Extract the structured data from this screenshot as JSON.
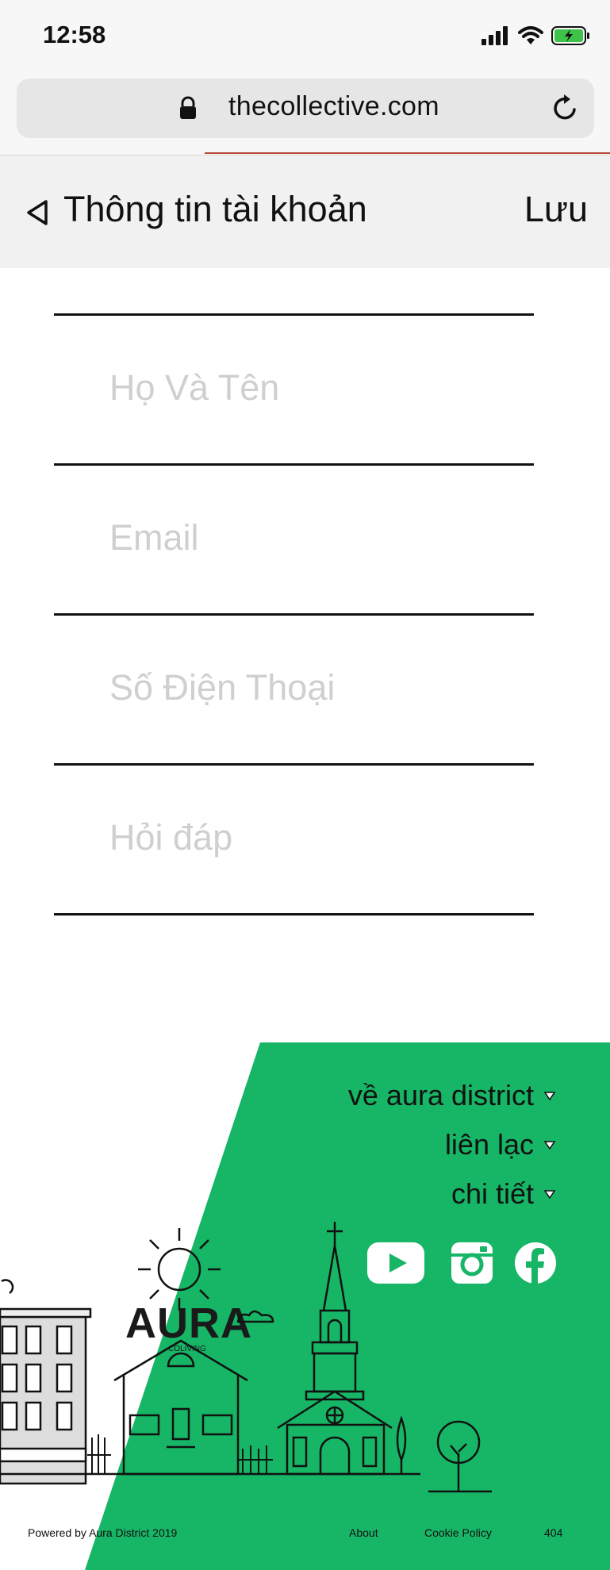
{
  "status_bar": {
    "time": "12:58"
  },
  "browser": {
    "url": "thecollective.com"
  },
  "nav": {
    "title": "Thông tin tài khoản",
    "save_label": "Lưu"
  },
  "form": {
    "fields": [
      {
        "placeholder": "Họ Và Tên",
        "value": ""
      },
      {
        "placeholder": "Email",
        "value": ""
      },
      {
        "placeholder": "Số Điện Thoại",
        "value": ""
      },
      {
        "placeholder": "Hỏi đáp",
        "value": ""
      }
    ]
  },
  "footer": {
    "links": [
      "về aura district",
      "liên lạc",
      "chi tiết"
    ],
    "social": [
      "youtube-icon",
      "instagram-icon",
      "facebook-icon"
    ],
    "logo": {
      "text": "AURA",
      "subtext": "COLIVING"
    },
    "powered_prefix": "Powered by ",
    "powered_link": "Aura District 2019",
    "bottom_links": [
      "About",
      "Cookie Policy",
      "404"
    ]
  },
  "colors": {
    "accent_green": "#17b566",
    "nav_bg": "#f0f1f0",
    "url_bar": "#e6e6e6"
  }
}
